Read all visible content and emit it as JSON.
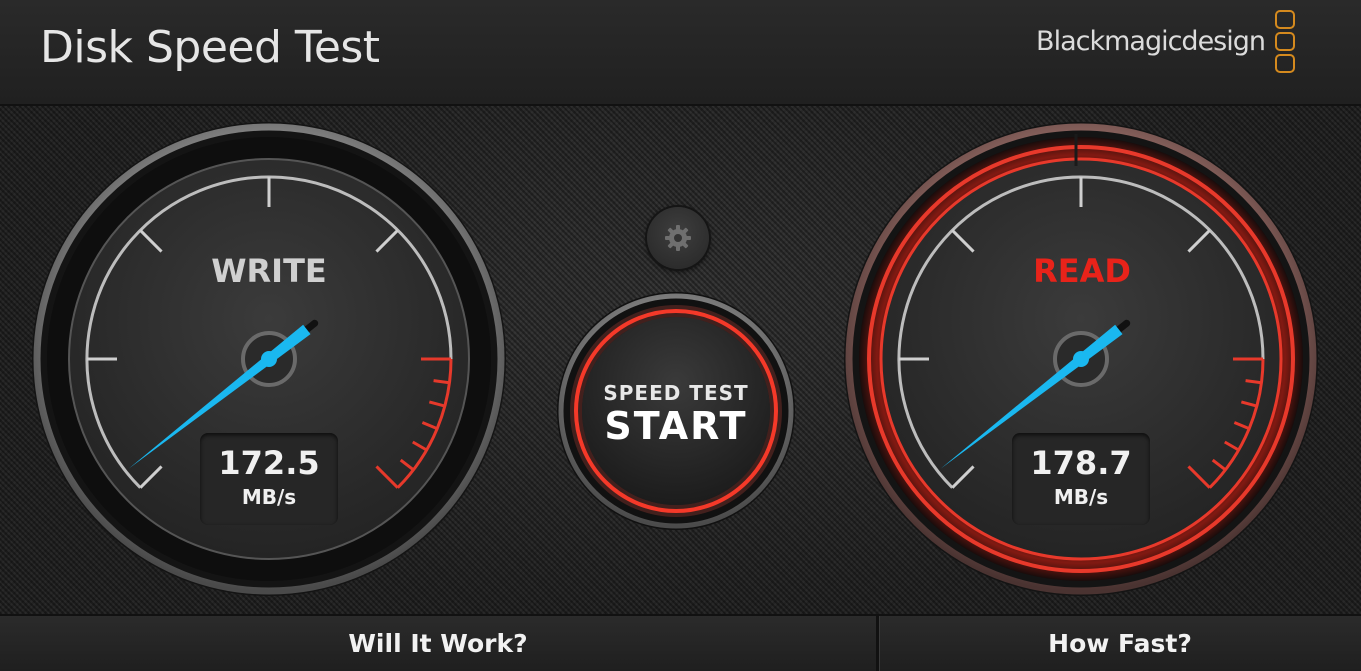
{
  "header": {
    "title": "Disk Speed Test",
    "brand": "Blackmagicdesign"
  },
  "write_gauge": {
    "label": "WRITE",
    "value": "172.5",
    "unit": "MB/s",
    "label_color": "#d0d0d0",
    "needle_color": "#1ab8f0",
    "redline_color": "#e6392b"
  },
  "read_gauge": {
    "label": "READ",
    "value": "178.7",
    "unit": "MB/s",
    "label_color": "#e8231a",
    "needle_color": "#1ab8f0",
    "ring_color": "#e8392b"
  },
  "start_button": {
    "top_label": "SPEED TEST",
    "main_label": "START",
    "ring_color": "#e8392b"
  },
  "settings": {
    "icon": "gear-icon"
  },
  "footer": {
    "left_label": "Will It Work?",
    "right_label": "How Fast?"
  },
  "colors": {
    "brand_logo": "#d58a1e",
    "background": "#1b1b1b"
  }
}
